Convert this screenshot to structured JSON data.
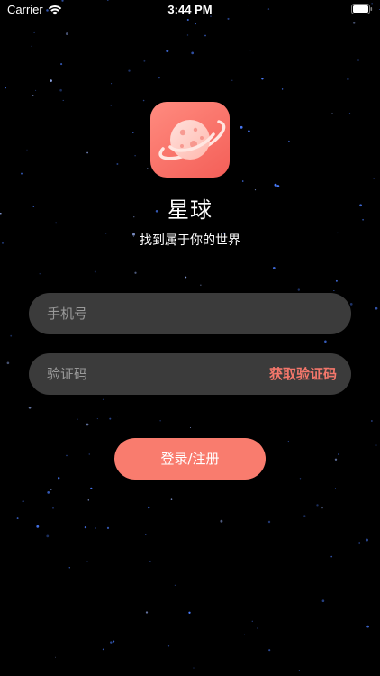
{
  "status_bar": {
    "carrier": "Carrier",
    "time": "3:44 PM"
  },
  "app": {
    "title": "星球",
    "subtitle": "找到属于你的世界"
  },
  "login_form": {
    "phone_placeholder": "手机号",
    "code_placeholder": "验证码",
    "get_code_label": "获取验证码",
    "submit_label": "登录/注册"
  },
  "colors": {
    "background": "#000000",
    "accent": "#f97c6e",
    "logo_gradient_start": "#ff8b7f",
    "logo_gradient_end": "#f45f58",
    "field_background": "#3b3b3b",
    "star": "#4a7dff"
  },
  "icons": {
    "wifi": "wifi-icon",
    "battery": "battery-icon",
    "logo": "planet-icon"
  }
}
